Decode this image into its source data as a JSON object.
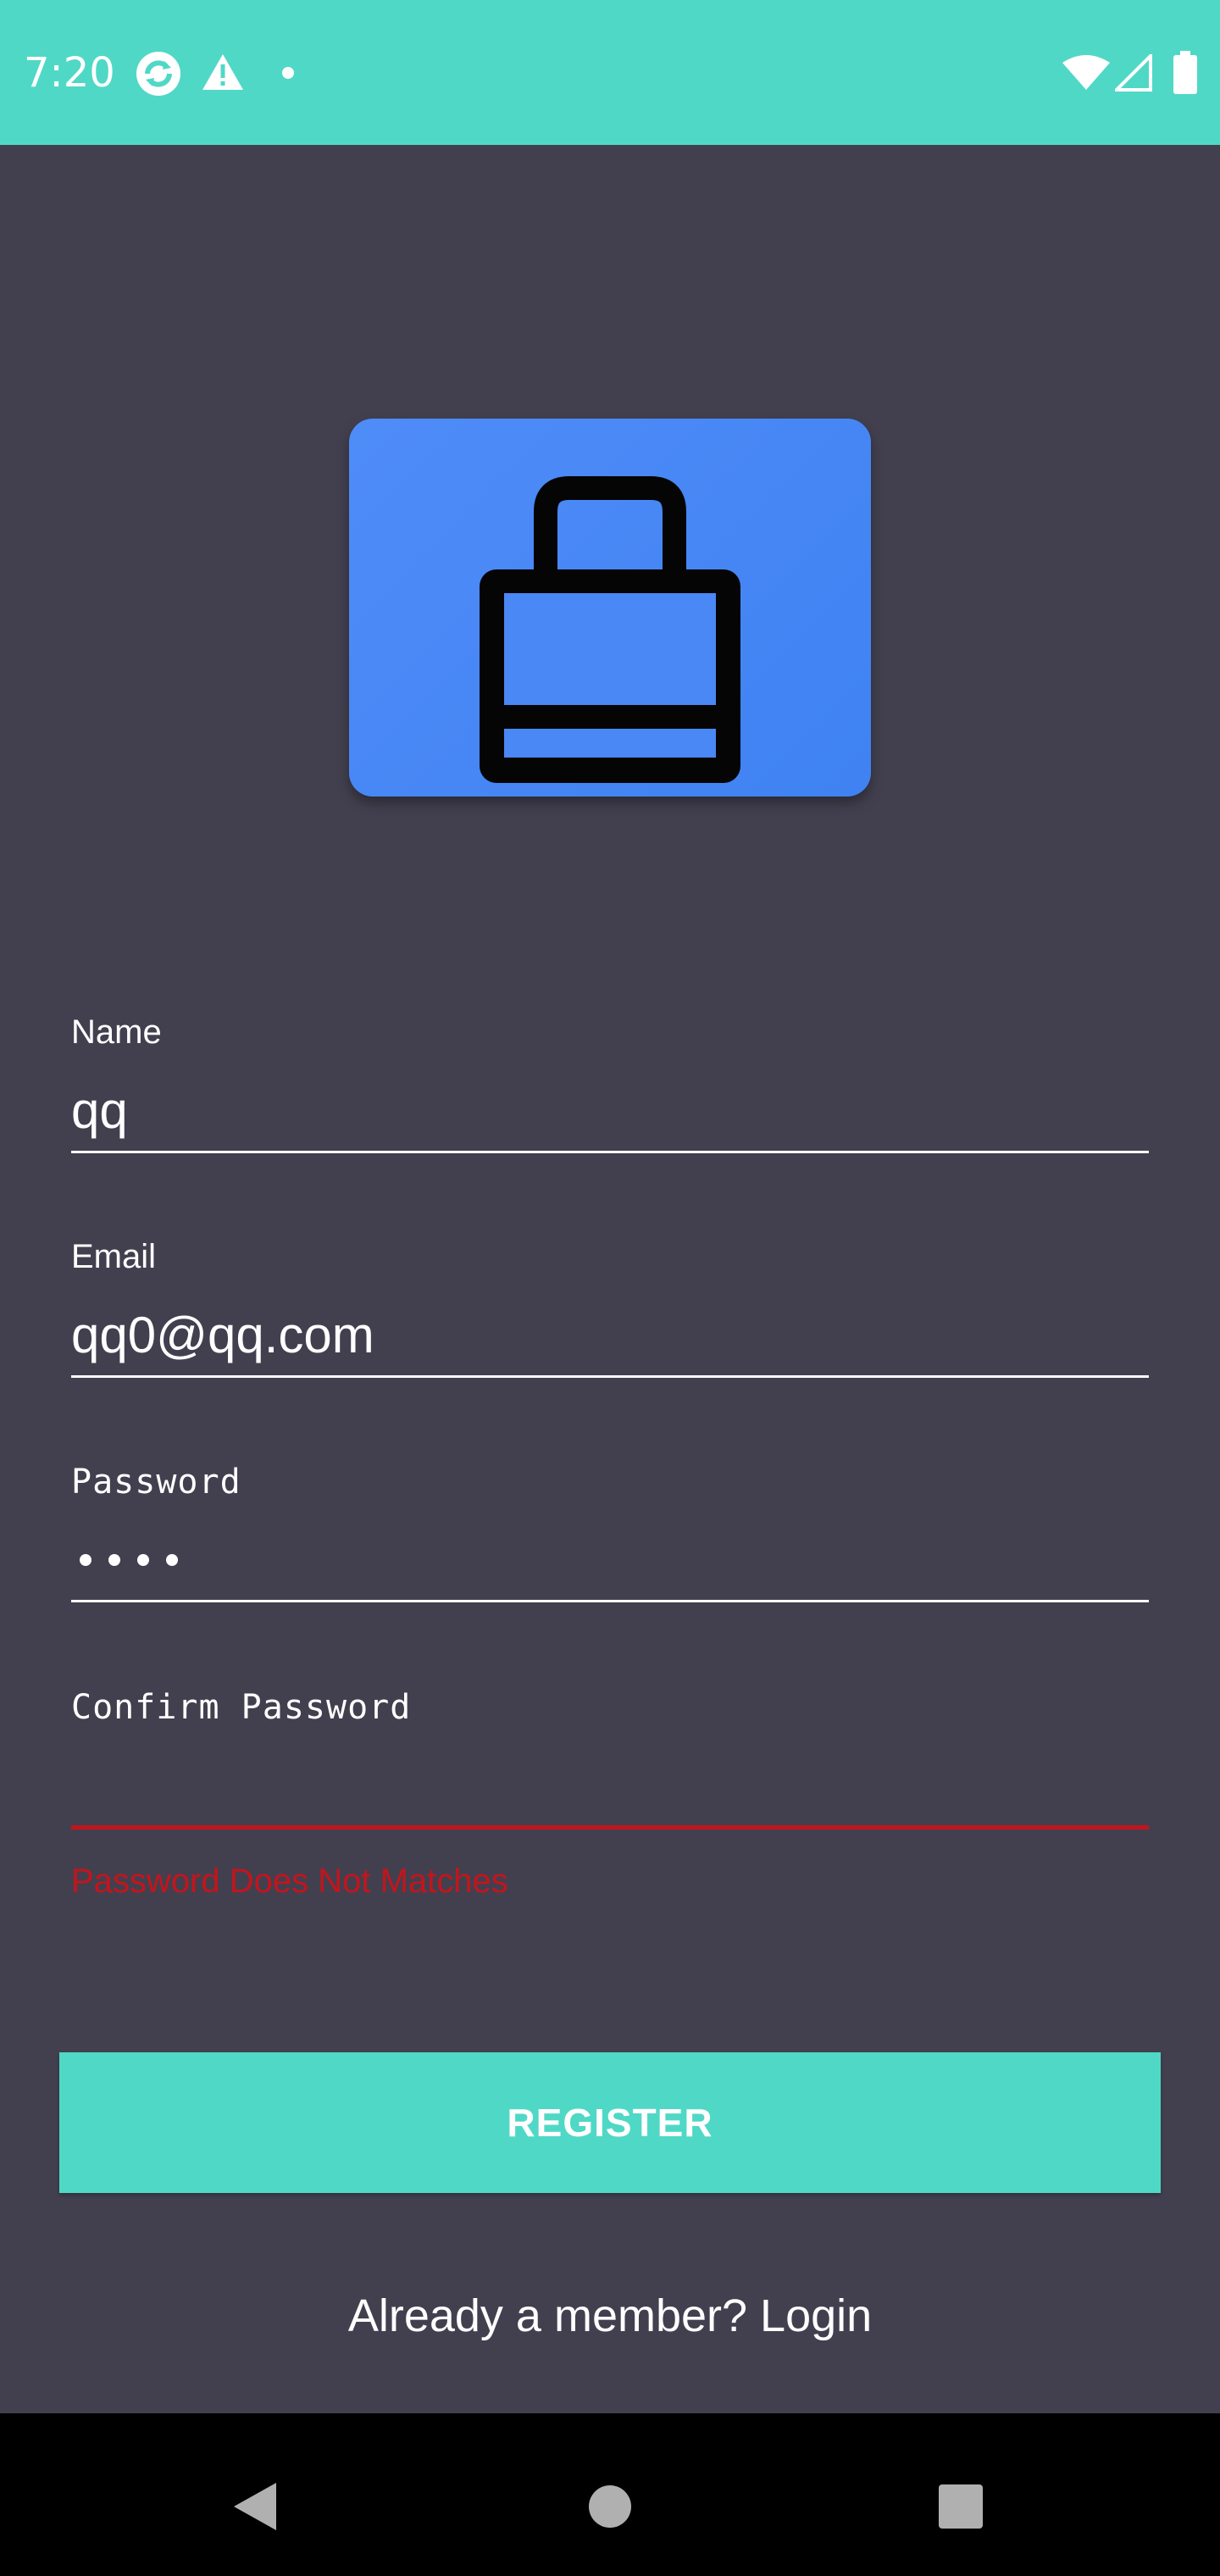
{
  "status_bar": {
    "time": "7:20",
    "icons": [
      "sync-icon",
      "warning-icon",
      "dot-icon",
      "wifi-icon",
      "signal-icon",
      "battery-icon"
    ],
    "background": "#50d8c6"
  },
  "logo": {
    "icon": "briefcase-icon",
    "background": "#4a88f5"
  },
  "form": {
    "name": {
      "label": "Name",
      "value": "qq"
    },
    "email": {
      "label": "Email",
      "value": "qq0@qq.com"
    },
    "password": {
      "label": "Password",
      "masked_length": 4
    },
    "confirm_password": {
      "label": "Confirm Password",
      "value": "",
      "error": "Password Does Not Matches"
    }
  },
  "register_button": {
    "label": "REGISTER",
    "color": "#50d8c6"
  },
  "login_link": {
    "text": "Already a member? Login"
  },
  "nav_bar": {
    "icons": [
      "back-icon",
      "home-icon",
      "recents-icon"
    ]
  },
  "colors": {
    "background": "#42404f",
    "error": "#c4141b",
    "accent": "#50d8c6"
  }
}
